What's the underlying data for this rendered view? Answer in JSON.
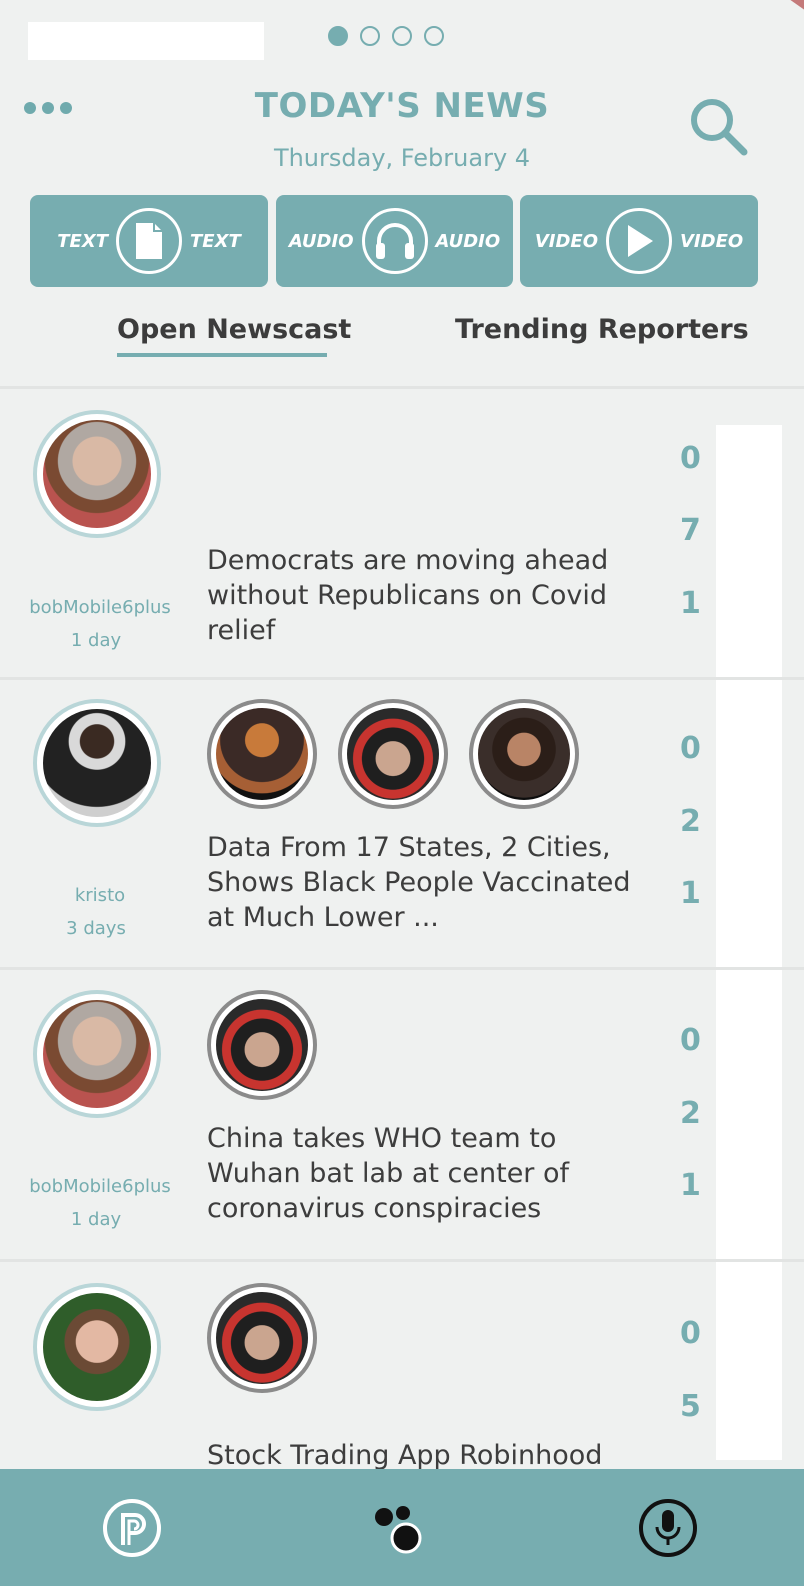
{
  "pagination": {
    "total": 4,
    "active": 0
  },
  "header": {
    "title": "TODAY'S NEWS",
    "date": "Thursday, February 4"
  },
  "modes": [
    {
      "left_label": "TEXT",
      "right_label": "TEXT",
      "icon": "document-icon"
    },
    {
      "left_label": "AUDIO",
      "right_label": "AUDIO",
      "icon": "headphones-icon"
    },
    {
      "left_label": "VIDEO",
      "right_label": "VIDEO",
      "icon": "play-icon"
    }
  ],
  "tabs": [
    {
      "label": "Open Newscast",
      "active": true
    },
    {
      "label": "Trending Reporters",
      "active": false
    }
  ],
  "stories": [
    {
      "author": "bobMobile6plus",
      "age": "1 day",
      "headline": "Democrats are moving ahead without Republicans on Covid relief",
      "counts": [
        "0",
        "7",
        "1"
      ]
    },
    {
      "author": "kristo",
      "age": "3 days",
      "headline": "Data From 17 States, 2 Cities, Shows Black People Vaccinated at Much Lower ...",
      "counts": [
        "0",
        "2",
        "1"
      ]
    },
    {
      "author": "bobMobile6plus",
      "age": "1 day",
      "headline": "China takes WHO team to Wuhan bat lab at center of coronavirus conspiracies",
      "counts": [
        "0",
        "2",
        "1"
      ]
    },
    {
      "author": "",
      "age": "",
      "headline": "Stock Trading App Robinhood",
      "counts": [
        "0",
        "5"
      ]
    }
  ],
  "colors": {
    "accent": "#76adb0",
    "background": "#eff1f0",
    "bottom_bar": "#77adb0"
  },
  "bottom_nav": [
    {
      "icon": "p-logo-icon"
    },
    {
      "icon": "bubbles-icon"
    },
    {
      "icon": "microphone-icon"
    }
  ]
}
